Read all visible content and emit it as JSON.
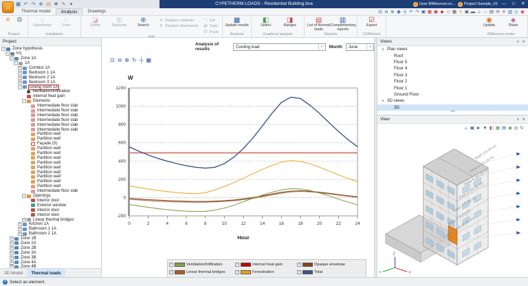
{
  "title_bar": {
    "title": "CYPETHERM LOADS - Residential Building.bva",
    "quick_access": [
      "save",
      "undo",
      "redo",
      "zoom",
      "open",
      "settings",
      "edit-config",
      "menu-down"
    ],
    "accounts": [
      {
        "label": "User BIMserver.ce..."
      },
      {
        "label": "Project Sample_01"
      }
    ],
    "window_controls": [
      "—",
      "□",
      "✕"
    ]
  },
  "tabs": [
    {
      "label": "Thermal model",
      "active": false
    },
    {
      "label": "Analysis",
      "active": true
    },
    {
      "label": "Drawings",
      "active": false
    }
  ],
  "view_tools": [
    "zoom-window",
    "zoom-out",
    "zoom-in",
    "orbit",
    "pan",
    "previous-view",
    "next-view",
    "screenshot",
    "ref-edit",
    "ref-lock",
    "magnet",
    "window",
    "grid",
    "light",
    "camera",
    "monitor",
    "perpendicular",
    "clock",
    "save-view",
    "comment",
    "tools",
    "layout",
    "globe",
    "help"
  ],
  "ribbon": {
    "groups": [
      {
        "label": "Project",
        "buttons": [
          {
            "icon": "weather",
            "name": "project-weather"
          },
          {
            "icon": "gear",
            "name": "project-settings"
          }
        ]
      },
      {
        "label": "Installation",
        "buttons": [
          {
            "icon": "house",
            "text": "Hypothesis",
            "disabled": true
          },
          {
            "icon": "house",
            "text": "Zone",
            "disabled": true
          }
        ]
      },
      {
        "label": "Edit",
        "buttons": [
          {
            "icon": "eraser",
            "text": "Delete",
            "disabled": true
          },
          {
            "icon": "duplicate",
            "text": "Duplicate",
            "disabled": true
          },
          {
            "icon": "search",
            "text": "Search"
          }
        ],
        "small_columns": [
          [
            {
              "icon": "arrow-up",
              "text": "Displace upwards",
              "disabled": true
            },
            {
              "icon": "arrow-down",
              "text": "Displace downwards",
              "disabled": true
            }
          ],
          [
            {
              "icon": "cut",
              "text": "Cut",
              "disabled": true
            },
            {
              "icon": "copy",
              "text": "Copy",
              "disabled": true
            },
            {
              "icon": "paste",
              "text": "Paste",
              "disabled": true
            }
          ]
        ]
      },
      {
        "label": "Analysis",
        "buttons": [
          {
            "icon": "calculator",
            "text": "Update results"
          }
        ]
      },
      {
        "label": "Graphical analysis",
        "buttons": [
          {
            "icon": "select",
            "text": "Select"
          },
          {
            "icon": "ranges",
            "text": "Ranges"
          }
        ]
      },
      {
        "label": "Reports",
        "buttons": [
          {
            "icon": "report-loads",
            "text": "List of thermal loads"
          },
          {
            "icon": "report-comp",
            "text": "Complementary reports"
          }
        ]
      },
      {
        "label": "COMcheck",
        "buttons": [
          {
            "icon": "export",
            "text": "Export"
          }
        ]
      },
      {
        "label": "BIMserver.center",
        "buttons": [
          {
            "icon": "bim-update",
            "text": "Update"
          },
          {
            "icon": "bim-share",
            "text": "Share"
          }
        ]
      }
    ]
  },
  "project_panel": {
    "header": "Project",
    "tree": [
      {
        "label": "Zone hypothesis",
        "depth": 0,
        "icon": "hypothesis",
        "expand": "-"
      },
      {
        "label": "H1",
        "depth": 1,
        "icon": "building",
        "expand": "-"
      },
      {
        "label": "Zone 1A",
        "depth": 2,
        "icon": "zone",
        "expand": "-"
      },
      {
        "label": "1A",
        "depth": 3,
        "icon": "dwelling",
        "expand": "-"
      },
      {
        "label": "Corridor 1A",
        "depth": 4,
        "icon": "room",
        "expand": "+"
      },
      {
        "label": "Bedroom 1 1A",
        "depth": 4,
        "icon": "room",
        "expand": "+"
      },
      {
        "label": "Bedroom 2 1A",
        "depth": 4,
        "icon": "room",
        "expand": "+"
      },
      {
        "label": "Bedroom 3 1A",
        "depth": 4,
        "icon": "room",
        "expand": "+"
      },
      {
        "label": "Dining room 1A",
        "depth": 4,
        "icon": "room",
        "expand": "-",
        "selected": true
      },
      {
        "label": "Ventilation/Infiltration",
        "depth": 5,
        "icon": "vent"
      },
      {
        "label": "Internal heat gain",
        "depth": 5,
        "icon": "heat"
      },
      {
        "label": "Elements",
        "depth": 5,
        "icon": "elements",
        "expand": "-"
      },
      {
        "label": "Intermediate floor slab",
        "depth": 6,
        "icon": "slab"
      },
      {
        "label": "Intermediate floor slab",
        "depth": 6,
        "icon": "slab"
      },
      {
        "label": "Intermediate floor slab",
        "depth": 6,
        "icon": "slab"
      },
      {
        "label": "Intermediate floor slab",
        "depth": 6,
        "icon": "slab"
      },
      {
        "label": "Intermediate floor slab",
        "depth": 6,
        "icon": "slab"
      },
      {
        "label": "Intermediate floor slab",
        "depth": 6,
        "icon": "slab"
      },
      {
        "label": "Partition wall",
        "depth": 6,
        "icon": "wall"
      },
      {
        "label": "Partition wall",
        "depth": 6,
        "icon": "wall"
      },
      {
        "label": "Façade (S)",
        "depth": 6,
        "icon": "facade"
      },
      {
        "label": "Partition wall",
        "depth": 6,
        "icon": "wall"
      },
      {
        "label": "Partition wall",
        "depth": 6,
        "icon": "wall"
      },
      {
        "label": "Partition wall",
        "depth": 6,
        "icon": "wall"
      },
      {
        "label": "Partition wall",
        "depth": 6,
        "icon": "wall"
      },
      {
        "label": "Partition wall",
        "depth": 6,
        "icon": "wall"
      },
      {
        "label": "Partition wall",
        "depth": 6,
        "icon": "wall"
      },
      {
        "label": "Partition wall",
        "depth": 6,
        "icon": "wall"
      },
      {
        "label": "Partition wall",
        "depth": 6,
        "icon": "wall"
      },
      {
        "label": "Partition wall",
        "depth": 6,
        "icon": "wall"
      },
      {
        "label": "Intermediate floor slab",
        "depth": 6,
        "icon": "slab"
      },
      {
        "label": "Openings",
        "depth": 5,
        "icon": "openings",
        "expand": "-"
      },
      {
        "label": "Interior door",
        "depth": 6,
        "icon": "door"
      },
      {
        "label": "Exterior window",
        "depth": 6,
        "icon": "window"
      },
      {
        "label": "Interior door",
        "depth": 6,
        "icon": "door"
      },
      {
        "label": "Interior door",
        "depth": 6,
        "icon": "door"
      },
      {
        "label": "Linear thermal bridges",
        "depth": 5,
        "icon": "bridges",
        "expand": "+"
      },
      {
        "label": "Kitchen 1A",
        "depth": 4,
        "icon": "room",
        "expand": "+"
      },
      {
        "label": "Bathroom 1 1A",
        "depth": 4,
        "icon": "room",
        "expand": "+"
      },
      {
        "label": "Bathroom 2 1A",
        "depth": 4,
        "icon": "room",
        "expand": "+"
      },
      {
        "label": "Zone 1B",
        "depth": 2,
        "icon": "zone",
        "expand": "+"
      },
      {
        "label": "Zone 2A",
        "depth": 2,
        "icon": "zone",
        "expand": "+"
      },
      {
        "label": "Zone 2B",
        "depth": 2,
        "icon": "zone",
        "expand": "+"
      },
      {
        "label": "Zone 3A",
        "depth": 2,
        "icon": "zone",
        "expand": "+"
      },
      {
        "label": "Zone 3B",
        "depth": 2,
        "icon": "zone",
        "expand": "+"
      },
      {
        "label": "Zone 4A",
        "depth": 2,
        "icon": "zone",
        "expand": "+"
      },
      {
        "label": "Zone 4B",
        "depth": 2,
        "icon": "zone",
        "expand": "+"
      }
    ],
    "bottom_tabs": [
      {
        "label": "3D Model",
        "active": false
      },
      {
        "label": "Thermal loads",
        "active": true
      }
    ]
  },
  "chart_controls": {
    "analysis_label": "Analysis of results",
    "analysis_value": "Cooling load",
    "month_label": "Month",
    "month_value": "June"
  },
  "chart_tools": [
    "zoom-window",
    "zoom-out",
    "zoom-in",
    "refresh",
    "pan",
    "export-image"
  ],
  "chart_data": {
    "type": "line",
    "title": "",
    "ylabel": "W",
    "xlabel": "Hour",
    "ylim": [
      -200,
      1200
    ],
    "xlim": [
      0,
      24
    ],
    "yticks": [
      1200,
      1000,
      800,
      600,
      400,
      200,
      0,
      -200
    ],
    "xticks": [
      0,
      2,
      4,
      6,
      8,
      10,
      12,
      14,
      16,
      18,
      20,
      22,
      24
    ],
    "grid": "dashed-horizontal",
    "legend_position": "bottom",
    "x": [
      0,
      1,
      2,
      3,
      4,
      5,
      6,
      7,
      8,
      9,
      10,
      11,
      12,
      13,
      14,
      15,
      16,
      17,
      18,
      19,
      20,
      21,
      22,
      23,
      24
    ],
    "series": [
      {
        "name": "Internal heat gain",
        "color": "#dd8d7f",
        "values": [
          490,
          490,
          490,
          490,
          490,
          490,
          490,
          490,
          490,
          490,
          490,
          490,
          490,
          490,
          490,
          490,
          490,
          490,
          490,
          490,
          490,
          490,
          490,
          490,
          490
        ]
      },
      {
        "name": "Linear thermal bridges",
        "color": "#b97850",
        "values": [
          -18,
          -26,
          -33,
          -39,
          -44,
          -48,
          -50,
          -51,
          -50,
          -47,
          -42,
          -34,
          -23,
          -9,
          9,
          29,
          48,
          62,
          67,
          63,
          53,
          41,
          28,
          15,
          4
        ]
      },
      {
        "name": "Opaque envelope",
        "color": "#7b4a21",
        "values": [
          -8,
          -15,
          -22,
          -28,
          -33,
          -37,
          -40,
          -42,
          -42,
          -39,
          -34,
          -26,
          -14,
          1,
          19,
          39,
          58,
          71,
          75,
          70,
          60,
          47,
          33,
          20,
          9
        ]
      },
      {
        "name": "Ventilation/Infiltration",
        "color": "#86a04a",
        "values": [
          -76,
          -92,
          -107,
          -120,
          -132,
          -142,
          -149,
          -152,
          -150,
          -137,
          -114,
          -83,
          -46,
          -8,
          28,
          59,
          84,
          98,
          94,
          78,
          51,
          19,
          -16,
          -49,
          -79
        ]
      },
      {
        "name": "Fenestration",
        "color": "#eeac2c",
        "values": [
          130,
          111,
          94,
          79,
          66,
          55,
          47,
          42,
          54,
          84,
          121,
          164,
          212,
          261,
          309,
          352,
          387,
          405,
          397,
          371,
          333,
          291,
          249,
          210,
          175
        ]
      },
      {
        "name": "Total",
        "color": "#3b5590",
        "values": [
          555,
          508,
          466,
          430,
          399,
          372,
          349,
          332,
          322,
          332,
          372,
          443,
          538,
          652,
          785,
          922,
          1042,
          1100,
          1085,
          1012,
          922,
          822,
          725,
          635,
          557
        ]
      }
    ]
  },
  "legend": {
    "items": [
      {
        "label": "Ventilation/Infiltration",
        "color": "#86a04a"
      },
      {
        "label": "Internal heat gain",
        "color": "#c00000"
      },
      {
        "label": "Opaque envelope",
        "color": "#8b4513"
      },
      {
        "label": "Linear thermal bridges",
        "color": "#b35a1f"
      },
      {
        "label": "Fenestration",
        "color": "#f0a500"
      },
      {
        "label": "Total",
        "color": "#3b5590"
      }
    ]
  },
  "views_panel": {
    "header": "Views",
    "groups": [
      {
        "label": "Plan views",
        "items": [
          "Roof",
          "Floor 5",
          "Floor 4",
          "Floor 3",
          "Floor 2",
          "Floor 1",
          "Ground Floor"
        ]
      },
      {
        "label": "3D views",
        "items": [
          "3D"
        ],
        "selected_item": "3D"
      }
    ]
  },
  "view_panel": {
    "header": "View",
    "tools": [
      "axes",
      "orbit",
      "select",
      "download",
      "split",
      "texture",
      "layers",
      "sphere",
      "visibility",
      "rotate"
    ],
    "floor_labels": [
      "Roof (19.29 m)",
      "Floor 5 (16.29 m)",
      "Floor 4 (13.29 m)",
      "Floor 3 (10.29 m)",
      "Floor 2 (7.29 m)",
      "Floor 1 (4.29 m)",
      "Ground Floor (0.00 m)"
    ],
    "axis_labels": {
      "x": "X",
      "y": "Y",
      "z": "Z"
    }
  },
  "status_bar": {
    "message": "Select an element."
  }
}
